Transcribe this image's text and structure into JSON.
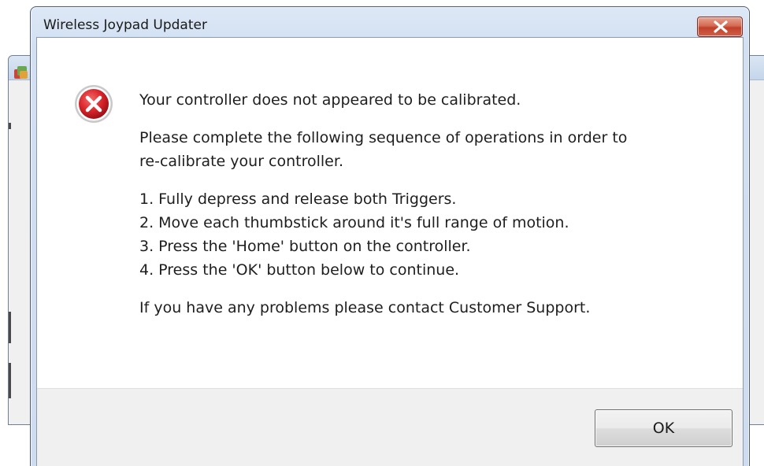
{
  "dialog": {
    "title": "Wireless Joypad Updater",
    "close_icon": "close-icon",
    "error_icon": "error-icon",
    "messages": {
      "headline": "Your controller does not appeared to be calibrated.",
      "instruction_line1": "Please complete the following sequence of operations in order to",
      "instruction_line2": "re-calibrate your controller.",
      "steps": [
        "1. Fully depress and release both Triggers.",
        "2. Move each thumbstick around it's full range of motion.",
        "3. Press the 'Home' button on the controller.",
        "4. Press the 'OK' button below to continue."
      ],
      "support": "If you have any problems please contact Customer Support."
    },
    "ok_label": "OK"
  },
  "background_window": {
    "app_icon": "app-icon"
  },
  "colors": {
    "close_button": "#c1402a",
    "error_icon_red": "#d8242a",
    "footer_bg": "#f0f0f0",
    "titlebar": "#d2e0f2"
  }
}
